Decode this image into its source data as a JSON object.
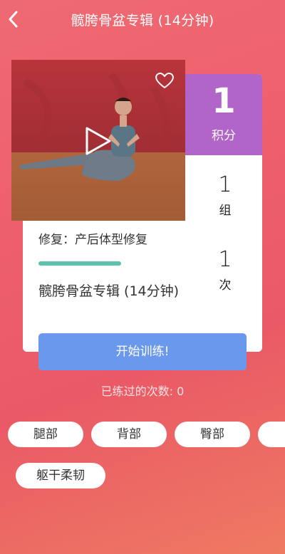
{
  "header": {
    "title": "髋胯骨盆专辑 (14分钟)",
    "back_icon": "chevron-left-icon"
  },
  "points": {
    "value": "1",
    "label": "积分"
  },
  "video": {
    "play_icon": "play-icon",
    "favorite_icon": "heart-outline-icon"
  },
  "stats": {
    "sets": {
      "value": "1",
      "unit": "组"
    },
    "times": {
      "value": "1",
      "unit": "次"
    }
  },
  "course": {
    "category": "修复：产后体型修复",
    "name": "髋胯骨盆专辑 (14分钟)"
  },
  "actions": {
    "start_label": "开始训练!"
  },
  "practice_count": "已练过的次数: 0",
  "tags": [
    "腿部",
    "背部",
    "臀部",
    "",
    "躯干柔韧"
  ],
  "colors": {
    "background_gradient": [
      "#ee6a73",
      "#ee7a62"
    ],
    "points_box": "#b265c9",
    "start_button": "#6a98ec",
    "accent_bar": "#5bc3ad"
  }
}
